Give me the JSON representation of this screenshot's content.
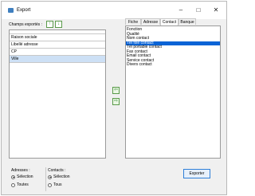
{
  "window": {
    "title": "Export"
  },
  "left_panel": {
    "label": "Champs exportés :",
    "fields": [
      "Raison sociale",
      "Libellé adresse",
      "CP",
      "Ville"
    ]
  },
  "tabs": [
    "Fiche",
    "Adresse",
    "Contact",
    "Banque"
  ],
  "contact_fields": [
    "Fonction",
    "Qualité",
    "Nom contact",
    "Tél fixe contact",
    "Tél portable contact",
    "Fax contact",
    "Email contact",
    "Service contact",
    "Divers contact"
  ],
  "adresses": {
    "label": "Adresses :",
    "options": [
      "Sélection",
      "Toutes"
    ]
  },
  "contacts": {
    "label": "Contacts :",
    "options": [
      "Sélection",
      "Tous"
    ]
  },
  "export_button": "Exporter"
}
